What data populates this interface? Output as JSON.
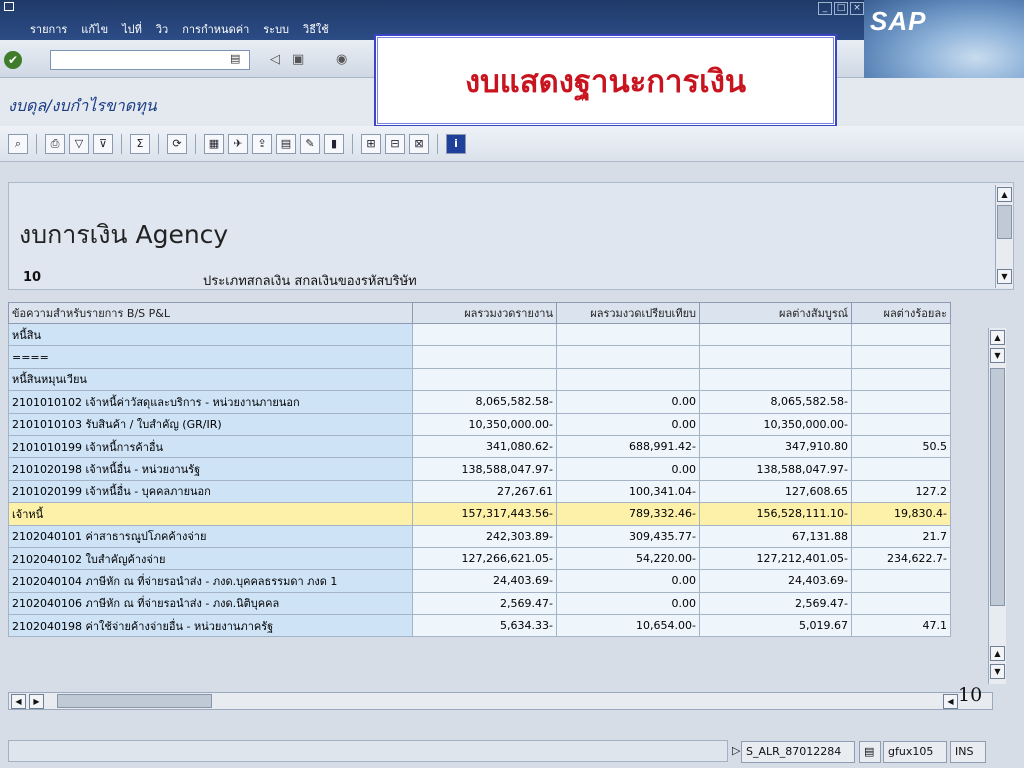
{
  "menu": {
    "items": [
      "รายการ",
      "แก้ไข",
      "ไปที่",
      "วิว",
      "การกำหนดค่า",
      "ระบบ",
      "วิธีใช้"
    ]
  },
  "brand": {
    "logo_text": "SAP"
  },
  "toolbar": {
    "command_value": "",
    "ok_icon": "check-icon"
  },
  "callout": {
    "title": "งบแสดงฐานะการเงิน"
  },
  "screen": {
    "title": "งบดุล/งบกำไรขาดทุน"
  },
  "report": {
    "heading": "งบการเงิน Agency",
    "code": "10",
    "description": "ประเภทสกลเงิน สกลเงินของรหัสบริษัท"
  },
  "table": {
    "columns": [
      "ข้อความสำหรับรายการ B/S P&L",
      "ผลรวมงวดรายงาน",
      "ผลรวมงวดเปรียบเทียบ",
      "ผลต่างสัมบูรณ์",
      "ผลต่างร้อยละ"
    ],
    "rows": [
      {
        "text": "หนี้สิน",
        "rep": "",
        "cmp": "",
        "abs": "",
        "pct": "",
        "highlight": false
      },
      {
        "text": "====",
        "rep": "",
        "cmp": "",
        "abs": "",
        "pct": "",
        "highlight": false
      },
      {
        "text": "หนี้สินหมุนเวียน",
        "rep": "",
        "cmp": "",
        "abs": "",
        "pct": "",
        "highlight": false
      },
      {
        "text": "2101010102 เจ้าหนี้ค่าวัสดุและบริการ - หน่วยงานภายนอก",
        "rep": "8,065,582.58-",
        "cmp": "0.00",
        "abs": "8,065,582.58-",
        "pct": "",
        "highlight": false
      },
      {
        "text": "2101010103 รับสินค้า / ใบสำคัญ (GR/IR)",
        "rep": "10,350,000.00-",
        "cmp": "0.00",
        "abs": "10,350,000.00-",
        "pct": "",
        "highlight": false
      },
      {
        "text": "2101010199 เจ้าหนี้การค้าอื่น",
        "rep": "341,080.62-",
        "cmp": "688,991.42-",
        "abs": "347,910.80",
        "pct": "50.5",
        "highlight": false
      },
      {
        "text": "2101020198 เจ้าหนี้อื่น - หน่วยงานรัฐ",
        "rep": "138,588,047.97-",
        "cmp": "0.00",
        "abs": "138,588,047.97-",
        "pct": "",
        "highlight": false
      },
      {
        "text": "2101020199 เจ้าหนี้อื่น - บุคคลภายนอก",
        "rep": "27,267.61",
        "cmp": "100,341.04-",
        "abs": "127,608.65",
        "pct": "127.2",
        "highlight": false
      },
      {
        "text": "เจ้าหนี้",
        "rep": "157,317,443.56-",
        "cmp": "789,332.46-",
        "abs": "156,528,111.10-",
        "pct": "19,830.4-",
        "highlight": true
      },
      {
        "text": "2102040101 ค่าสาธารณูปโภคค้างจ่าย",
        "rep": "242,303.89-",
        "cmp": "309,435.77-",
        "abs": "67,131.88",
        "pct": "21.7",
        "highlight": false
      },
      {
        "text": "2102040102 ใบสำคัญค้างจ่าย",
        "rep": "127,266,621.05-",
        "cmp": "54,220.00-",
        "abs": "127,212,401.05-",
        "pct": "234,622.7-",
        "highlight": false
      },
      {
        "text": "2102040104 ภาษีหัก ณ ที่จ่ายรอนำส่ง - ภงด.บุคคลธรรมดา ภงด 1",
        "rep": "24,403.69-",
        "cmp": "0.00",
        "abs": "24,403.69-",
        "pct": "",
        "highlight": false
      },
      {
        "text": "2102040106 ภาษีหัก ณ ที่จ่ายรอนำส่ง - ภงด.นิติบุคคล",
        "rep": "2,569.47-",
        "cmp": "0.00",
        "abs": "2,569.47-",
        "pct": "",
        "highlight": false
      },
      {
        "text": "2102040198 ค่าใช้จ่ายค้างจ่ายอื่น - หน่วยงานภาครัฐ",
        "rep": "5,634.33-",
        "cmp": "10,654.00-",
        "abs": "5,019.67",
        "pct": "47.1",
        "highlight": false
      }
    ]
  },
  "page_number": "10",
  "status": {
    "transaction": "S_ALR_87012284",
    "user": "gfux105",
    "mode": "INS"
  }
}
